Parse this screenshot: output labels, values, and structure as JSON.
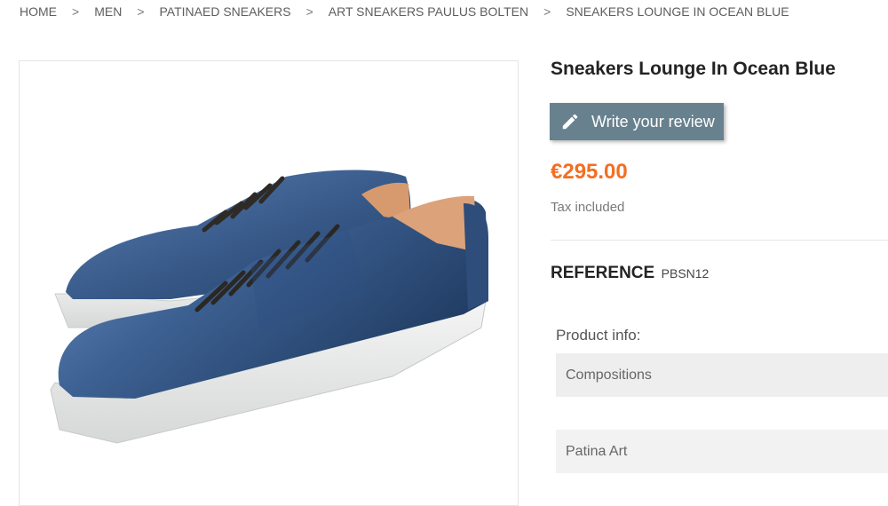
{
  "breadcrumb": {
    "items": [
      "Home",
      "Men",
      "Patinaed Sneakers",
      "Art sneakers Paulus Bolten",
      "Sneakers Lounge in Ocean Blue"
    ],
    "separator": ">"
  },
  "product": {
    "title": "Sneakers Lounge In Ocean Blue",
    "review_button": "Write your review",
    "price": "€295.00",
    "tax_note": "Tax included",
    "reference_label": "Reference",
    "reference_value": "PBSN12",
    "image_alt": "Sneakers Lounge in Ocean Blue shoes"
  },
  "product_info": {
    "title": "Product info:",
    "rows": [
      "Compositions",
      "Patina Art"
    ]
  },
  "colors": {
    "price": "#f26f22",
    "review_button": "#68818e",
    "shoe_leather": "#3f5f8c",
    "sole": "#e9ebea"
  }
}
